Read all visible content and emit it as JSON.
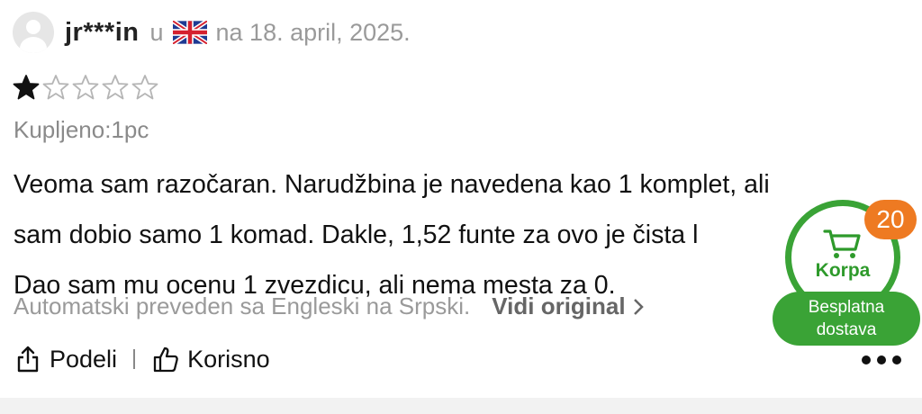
{
  "reviewer": {
    "name": "jr***in",
    "location_prefix": "u",
    "date": "na 18. april, 2025."
  },
  "rating": 1,
  "max_rating": 5,
  "purchased": "Kupljeno:1pc",
  "review_lines": [
    "Veoma sam razočaran. Narudžbina je navedena kao 1 komplet, ali",
    "sam dobio samo 1 komad. Dakle, 1,52 funte za ovo je čista l",
    "Dao sam mu ocenu 1 zvezdicu, ali nema mesta za 0."
  ],
  "translation": {
    "note": "Automatski preveden sa Engleski na Srpski.",
    "link": "Vidi original"
  },
  "actions": {
    "share": "Podeli",
    "helpful": "Korisno"
  },
  "cart": {
    "count": "20",
    "label": "Korpa",
    "shipping_line1": "Besplatna",
    "shipping_line2": "dostava"
  },
  "icons": {
    "avatar": "avatar-icon",
    "flag": "uk-flag-icon",
    "share": "share-icon",
    "helpful": "thumbs-up-icon",
    "more": "more-dots-icon",
    "cart": "cart-icon"
  },
  "colors": {
    "star_filled": "#111111",
    "star_empty": "#b5b5b5",
    "cart_green": "#3aa336",
    "badge_orange": "#ee7a22"
  }
}
